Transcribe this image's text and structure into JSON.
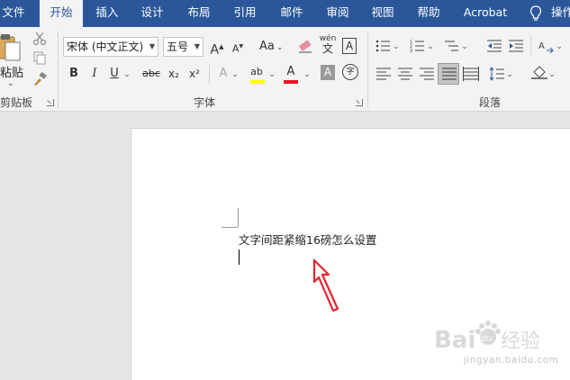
{
  "tabs": [
    {
      "label": "文件"
    },
    {
      "label": "开始",
      "active": true
    },
    {
      "label": "插入"
    },
    {
      "label": "设计"
    },
    {
      "label": "布局"
    },
    {
      "label": "引用"
    },
    {
      "label": "邮件"
    },
    {
      "label": "审阅"
    },
    {
      "label": "视图"
    },
    {
      "label": "帮助"
    },
    {
      "label": "Acrobat"
    },
    {
      "label": "操作"
    }
  ],
  "clipboard": {
    "paste_label": "粘贴",
    "group_label": "剪贴板"
  },
  "font": {
    "name_value": "宋体 (中文正文)",
    "size_value": "五号",
    "grow_glyph": "A",
    "shrink_glyph": "A",
    "case_glyph": "Aa",
    "phonetic_glyph": "wén",
    "border_glyph": "A",
    "bold_glyph": "B",
    "italic_glyph": "I",
    "underline_glyph": "U",
    "strike_glyph": "abc",
    "sub_glyph": "x₂",
    "sup_glyph": "x²",
    "effects_glyph": "A",
    "highlight_glyph": "ab",
    "color_glyph": "A",
    "shade_glyph": "A",
    "circle_glyph": "字",
    "group_label": "字体",
    "highlight_color": "#ffff00",
    "font_color": "#e81123"
  },
  "paragraph": {
    "group_label": "段落"
  },
  "document": {
    "text": "文字间距紧缩16磅怎么设置"
  },
  "colors": {
    "accent": "#2b579a",
    "arrow": "#e8232e"
  },
  "watermark": {
    "domain": "jingyan.baidu.com"
  }
}
